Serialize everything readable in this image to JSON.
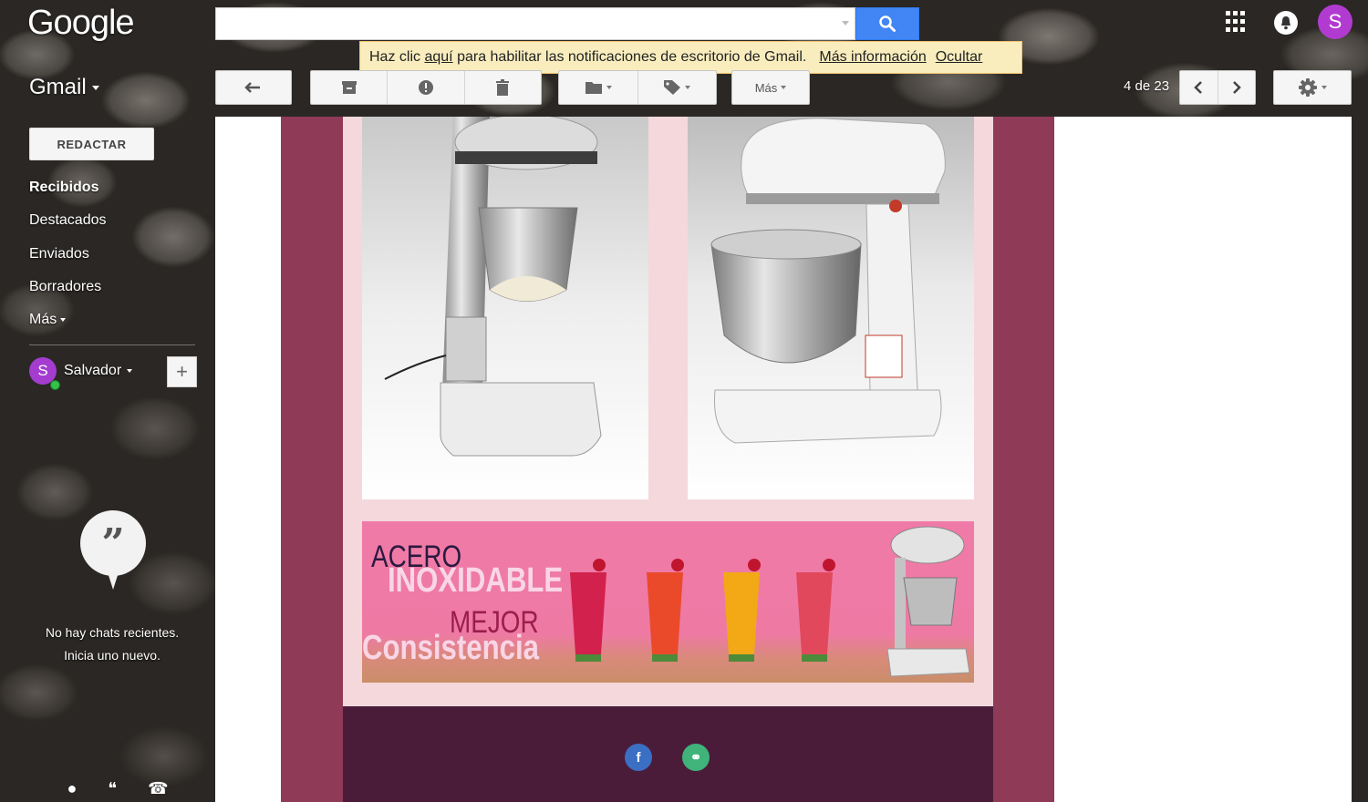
{
  "header": {
    "logo": "Google",
    "app_label": "Gmail",
    "avatar_letter": "S"
  },
  "notification": {
    "text_before": "Haz clic",
    "link_here": "aquí",
    "text_after": "para habilitar las notificaciones de escritorio de Gmail.",
    "more_info": "Más información",
    "hide": "Ocultar"
  },
  "toolbar": {
    "more_label": "Más",
    "page_count": "4 de 23"
  },
  "sidebar": {
    "compose_label": "REDACTAR",
    "items": [
      {
        "label": "Recibidos"
      },
      {
        "label": "Destacados"
      },
      {
        "label": "Enviados"
      },
      {
        "label": "Borradores"
      },
      {
        "label": "Más"
      }
    ],
    "user_name": "Salvador",
    "user_initial": "S"
  },
  "chat": {
    "empty_line1": "No hay chats recientes.",
    "empty_line2": "Inicia uno nuevo."
  },
  "email": {
    "banner": {
      "line1": "ACERO",
      "line2": "INOXIDABLE",
      "line3": "MEJOR",
      "line4": "Consistencia"
    },
    "social": [
      {
        "icon": "facebook-icon",
        "glyph": "f",
        "color": "#3b6fc4"
      },
      {
        "icon": "link-icon",
        "glyph": "⚭",
        "color": "#3fb37a"
      }
    ]
  },
  "colors": {
    "accent_blue": "#4285f4",
    "email_frame": "#8f3a57",
    "email_inner": "#f4d8dc",
    "email_footer": "#4a1c3a",
    "avatar": "#b13bd1"
  }
}
